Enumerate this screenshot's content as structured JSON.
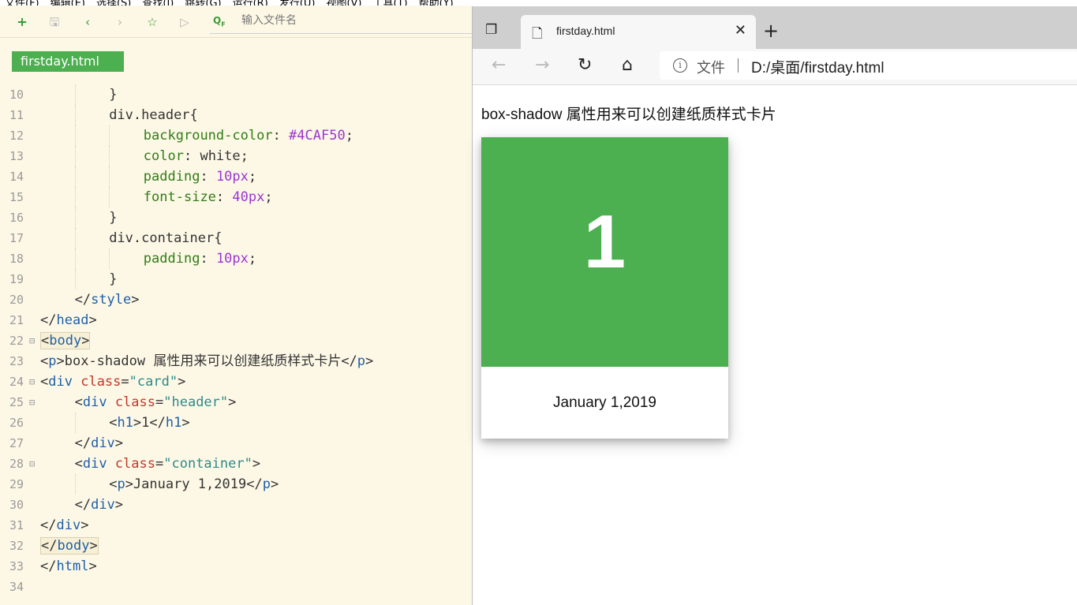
{
  "editor": {
    "menu": [
      "文件(F)",
      "编辑(E)",
      "选择(S)",
      "查找(I)",
      "跳转(G)",
      "运行(R)",
      "发行(U)",
      "视图(V)",
      "工具(T)",
      "帮助(Y)"
    ],
    "toolbar": {
      "new_icon": "new-file-icon",
      "save_icon": "save-icon",
      "back_icon": "back-icon",
      "forward_icon": "forward-icon",
      "favorite_icon": "star-icon",
      "run_icon": "run-icon"
    },
    "search_placeholder": "输入文件名",
    "file_tab": "firstday.html",
    "accent_color": "#4caf50",
    "lines": [
      {
        "n": "10",
        "indent": 2,
        "segments": [
          {
            "t": "}",
            "c": "plain"
          }
        ]
      },
      {
        "n": "11",
        "indent": 2,
        "segments": [
          {
            "t": "div.header{",
            "c": "plain"
          }
        ]
      },
      {
        "n": "12",
        "indent": 3,
        "segments": [
          {
            "t": "background-color",
            "c": "prop"
          },
          {
            "t": ": ",
            "c": "plain"
          },
          {
            "t": "#4CAF50",
            "c": "num"
          },
          {
            "t": ";",
            "c": "plain"
          }
        ]
      },
      {
        "n": "13",
        "indent": 3,
        "segments": [
          {
            "t": "color",
            "c": "prop"
          },
          {
            "t": ": white;",
            "c": "plain"
          }
        ]
      },
      {
        "n": "14",
        "indent": 3,
        "segments": [
          {
            "t": "padding",
            "c": "prop"
          },
          {
            "t": ": ",
            "c": "plain"
          },
          {
            "t": "10px",
            "c": "num"
          },
          {
            "t": ";",
            "c": "plain"
          }
        ]
      },
      {
        "n": "15",
        "indent": 3,
        "segments": [
          {
            "t": "font-size",
            "c": "prop"
          },
          {
            "t": ": ",
            "c": "plain"
          },
          {
            "t": "40px",
            "c": "num"
          },
          {
            "t": ";",
            "c": "plain"
          }
        ]
      },
      {
        "n": "16",
        "indent": 2,
        "segments": [
          {
            "t": "}",
            "c": "plain"
          }
        ]
      },
      {
        "n": "17",
        "indent": 2,
        "segments": [
          {
            "t": "div.container{",
            "c": "plain"
          }
        ]
      },
      {
        "n": "18",
        "indent": 3,
        "segments": [
          {
            "t": "padding",
            "c": "prop"
          },
          {
            "t": ": ",
            "c": "plain"
          },
          {
            "t": "10px",
            "c": "num"
          },
          {
            "t": ";",
            "c": "plain"
          }
        ]
      },
      {
        "n": "19",
        "indent": 2,
        "segments": [
          {
            "t": "}",
            "c": "plain"
          }
        ]
      },
      {
        "n": "20",
        "indent": 1,
        "segments": [
          {
            "t": "</",
            "c": "plain"
          },
          {
            "t": "style",
            "c": "tag"
          },
          {
            "t": ">",
            "c": "plain"
          }
        ]
      },
      {
        "n": "21",
        "indent": 0,
        "segments": [
          {
            "t": "</",
            "c": "plain"
          },
          {
            "t": "head",
            "c": "tag"
          },
          {
            "t": ">",
            "c": "plain"
          }
        ]
      },
      {
        "n": "22",
        "indent": 0,
        "fold": "⊟",
        "hl": true,
        "segments": [
          {
            "t": "<",
            "c": "plain"
          },
          {
            "t": "body",
            "c": "tag"
          },
          {
            "t": ">",
            "c": "plain"
          }
        ]
      },
      {
        "n": "23",
        "indent": 0,
        "segments": [
          {
            "t": "<",
            "c": "plain"
          },
          {
            "t": "p",
            "c": "tag"
          },
          {
            "t": ">box-shadow 属性用来可以创建纸质样式卡片</",
            "c": "plain"
          },
          {
            "t": "p",
            "c": "tag"
          },
          {
            "t": ">",
            "c": "plain"
          }
        ]
      },
      {
        "n": "24",
        "indent": 0,
        "fold": "⊟",
        "segments": [
          {
            "t": "<",
            "c": "plain"
          },
          {
            "t": "div",
            "c": "tag"
          },
          {
            "t": " ",
            "c": "plain"
          },
          {
            "t": "class",
            "c": "attr"
          },
          {
            "t": "=",
            "c": "plain"
          },
          {
            "t": "\"card\"",
            "c": "str"
          },
          {
            "t": ">",
            "c": "plain"
          }
        ]
      },
      {
        "n": "25",
        "indent": 1,
        "fold": "⊟",
        "segments": [
          {
            "t": "<",
            "c": "plain"
          },
          {
            "t": "div",
            "c": "tag"
          },
          {
            "t": " ",
            "c": "plain"
          },
          {
            "t": "class",
            "c": "attr"
          },
          {
            "t": "=",
            "c": "plain"
          },
          {
            "t": "\"header\"",
            "c": "str"
          },
          {
            "t": ">",
            "c": "plain"
          }
        ]
      },
      {
        "n": "26",
        "indent": 2,
        "segments": [
          {
            "t": "<",
            "c": "plain"
          },
          {
            "t": "h1",
            "c": "tag"
          },
          {
            "t": ">1</",
            "c": "plain"
          },
          {
            "t": "h1",
            "c": "tag"
          },
          {
            "t": ">",
            "c": "plain"
          }
        ]
      },
      {
        "n": "27",
        "indent": 1,
        "segments": [
          {
            "t": "</",
            "c": "plain"
          },
          {
            "t": "div",
            "c": "tag"
          },
          {
            "t": ">",
            "c": "plain"
          }
        ]
      },
      {
        "n": "28",
        "indent": 1,
        "fold": "⊟",
        "segments": [
          {
            "t": "<",
            "c": "plain"
          },
          {
            "t": "div",
            "c": "tag"
          },
          {
            "t": " ",
            "c": "plain"
          },
          {
            "t": "class",
            "c": "attr"
          },
          {
            "t": "=",
            "c": "plain"
          },
          {
            "t": "\"container\"",
            "c": "str"
          },
          {
            "t": ">",
            "c": "plain"
          }
        ]
      },
      {
        "n": "29",
        "indent": 2,
        "segments": [
          {
            "t": "<",
            "c": "plain"
          },
          {
            "t": "p",
            "c": "tag"
          },
          {
            "t": ">January 1,2019</",
            "c": "plain"
          },
          {
            "t": "p",
            "c": "tag"
          },
          {
            "t": ">",
            "c": "plain"
          }
        ]
      },
      {
        "n": "30",
        "indent": 1,
        "segments": [
          {
            "t": "</",
            "c": "plain"
          },
          {
            "t": "div",
            "c": "tag"
          },
          {
            "t": ">",
            "c": "plain"
          }
        ]
      },
      {
        "n": "31",
        "indent": 0,
        "segments": [
          {
            "t": "</",
            "c": "plain"
          },
          {
            "t": "div",
            "c": "tag"
          },
          {
            "t": ">",
            "c": "plain"
          }
        ]
      },
      {
        "n": "32",
        "indent": 0,
        "hl": true,
        "segments": [
          {
            "t": "</",
            "c": "plain"
          },
          {
            "t": "body",
            "c": "tag"
          },
          {
            "t": ">",
            "c": "plain"
          }
        ]
      },
      {
        "n": "33",
        "indent": 0,
        "segments": [
          {
            "t": "</",
            "c": "plain"
          },
          {
            "t": "html",
            "c": "tag"
          },
          {
            "t": ">",
            "c": "plain"
          }
        ]
      },
      {
        "n": "34",
        "indent": 0,
        "segments": []
      }
    ]
  },
  "browser": {
    "tab_title": "firstday.html",
    "address": {
      "label": "文件",
      "url": "D:/桌面/firstday.html"
    },
    "page": {
      "intro": "box-shadow 属性用来可以创建纸质样式卡片",
      "card_number": "1",
      "card_date": "January 1,2019",
      "card_color": "#4caf50"
    }
  }
}
